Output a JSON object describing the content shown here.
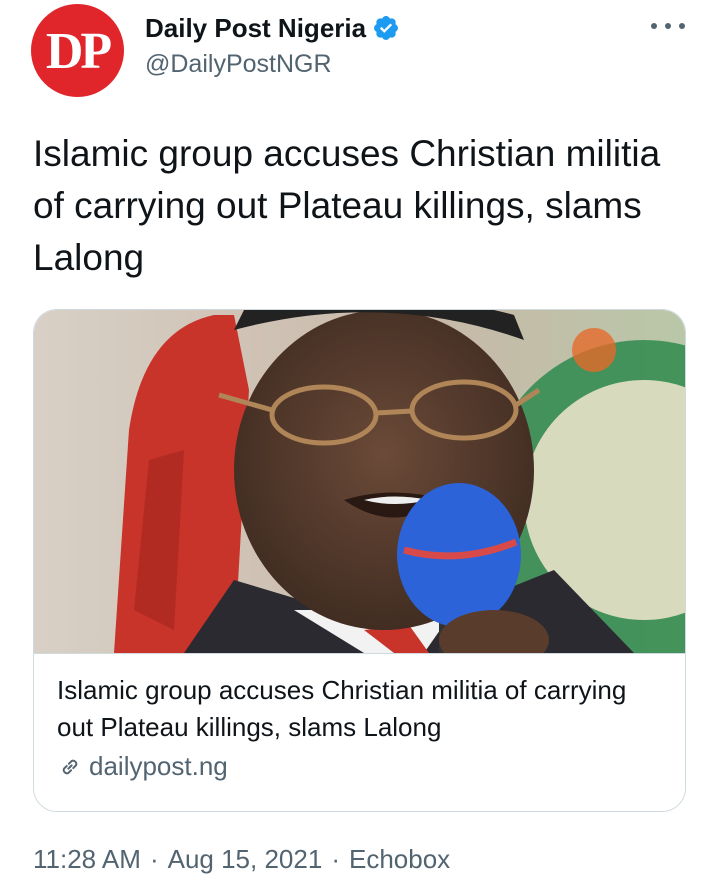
{
  "author": {
    "avatar_text": "DP",
    "display_name": "Daily Post Nigeria",
    "handle": "@DailyPostNGR",
    "verified": true
  },
  "tweet": {
    "text": "Islamic group accuses Christian militia of carrying out Plateau killings, slams Lalong"
  },
  "card": {
    "title": "Islamic group accuses Christian militia of carrying out Plateau killings, slams Lalong",
    "domain": "dailypost.ng"
  },
  "meta": {
    "time": "11:28 AM",
    "separator": "·",
    "date": "Aug 15, 2021",
    "source": "Echobox"
  },
  "colors": {
    "avatar_bg": "#e0262b",
    "verified_blue": "#1d9bf0",
    "secondary_text": "#536471",
    "primary_text": "#0f1419",
    "border": "#cfd9de"
  }
}
